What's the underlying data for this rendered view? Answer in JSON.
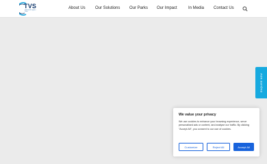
{
  "header": {
    "logo": {
      "text": "TVS",
      "subtitle": "Industrial & Logistics Parks"
    },
    "nav": [
      {
        "label": "About Us"
      },
      {
        "label": "Our Solutions"
      },
      {
        "label": "Our Parks"
      },
      {
        "label": "Our Impact"
      },
      {
        "label": "In Media"
      },
      {
        "label": "Contact Us"
      }
    ],
    "search_icon": "search-icon"
  },
  "side_tab": {
    "label": "ENQUIRE NOW"
  },
  "cookie_banner": {
    "title": "We value your privacy",
    "body": "We use cookies to enhance your browsing experience, serve personalised ads or content, and analyse our traffic. By clicking \"Accept All\", you consent to our use of cookies.",
    "buttons": {
      "customize": "Customize",
      "reject": "Reject All",
      "accept": "Accept All"
    }
  },
  "colors": {
    "brand_blue": "#143a6e",
    "accent_cyan": "#16a9df",
    "button_blue": "#1863dc",
    "hero_bg": "#ebebeb"
  }
}
